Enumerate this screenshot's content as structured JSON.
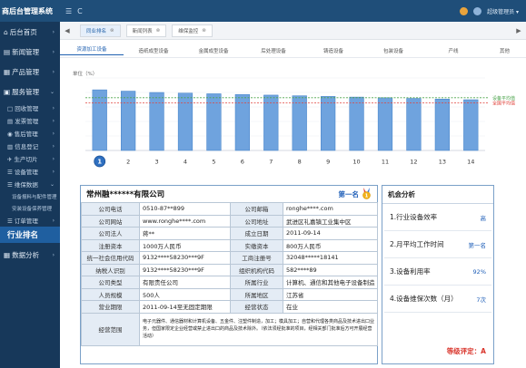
{
  "app": {
    "title": "商后台管理系统",
    "top_icon": "C",
    "user": "超级管理员 ▾"
  },
  "sidebar": {
    "items": [
      {
        "label": "后台首页",
        "icon": "⌂",
        "caret": "›"
      },
      {
        "label": "新闻管理",
        "icon": "▤",
        "caret": "›"
      },
      {
        "label": "产品管理",
        "icon": "▦",
        "caret": "›"
      },
      {
        "label": "服务管理",
        "icon": "▣",
        "caret": "⌄"
      }
    ],
    "subs": [
      {
        "label": "□ 回收管理",
        "caret": "›"
      },
      {
        "label": "▤ 发票管理",
        "caret": "›"
      },
      {
        "label": "◉ 售后管理",
        "caret": "›"
      },
      {
        "label": "▥ 信息登记",
        "caret": "›"
      },
      {
        "label": "✈ 生产切片",
        "caret": "›"
      },
      {
        "label": "☰ 设备管理",
        "caret": "›"
      },
      {
        "label": "☰ 维保数据",
        "caret": "⌄"
      }
    ],
    "subs2": [
      "设备报料与配件管理",
      "安装设备保养管理"
    ],
    "sub_order": {
      "label": "☰ 订单管理",
      "caret": "›"
    },
    "active": "行业排名",
    "bottom": {
      "label": "数据分析",
      "icon": "▦",
      "caret": "›"
    }
  },
  "tabs": {
    "left_arrow": "◀",
    "right_arrow": "▶",
    "items": [
      {
        "label": "同业排名",
        "active": true
      },
      {
        "label": "新闻列表",
        "active": false
      },
      {
        "label": "维保监控",
        "active": false
      }
    ],
    "close": "⊗"
  },
  "categories": [
    "资源加工设备",
    "造纸成型设备",
    "金属成型设备",
    "后处理设备",
    "铸造设备",
    "包装设备",
    "产线",
    "其他"
  ],
  "chart_data": {
    "type": "bar",
    "categories": [
      "1",
      "2",
      "3",
      "4",
      "5",
      "6",
      "7",
      "8",
      "9",
      "10",
      "11",
      "12",
      "13",
      "14"
    ],
    "values": [
      92,
      90,
      88,
      87,
      86,
      85,
      84,
      83,
      82,
      81,
      80,
      79,
      78,
      77
    ],
    "ylabel": "单位（%）",
    "ylim": [
      0,
      110
    ],
    "references": [
      {
        "name": "设备平均值",
        "value": 80,
        "color": "#4aa34a"
      },
      {
        "name": "全国平均值",
        "value": 72,
        "color": "#e0443c"
      }
    ],
    "highlight_index": 0,
    "bar_color": "#6fa3de"
  },
  "company": {
    "name": "常州融******有限公司",
    "rank": "第一名",
    "medal_label": "1",
    "rows": [
      {
        "l1": "公司电话",
        "v1": "0510-87**899",
        "l2": "公司邮箱",
        "v2": "ronghe****.com"
      },
      {
        "l1": "公司网站",
        "v1": "www.ronghe****.com",
        "l2": "公司地址",
        "v2": "武进区礼嘉镇工业集中区"
      },
      {
        "l1": "公司法人",
        "v1": "蒋**",
        "l2": "成立日期",
        "v2": "2011-09-14"
      },
      {
        "l1": "注册资本",
        "v1": "1000万人民币",
        "l2": "实缴资本",
        "v2": "800万人民币"
      },
      {
        "l1": "统一社会信用代码",
        "v1": "9132****58230***9F",
        "l2": "工商注册号",
        "v2": "32048*****18141"
      },
      {
        "l1": "纳税人识别",
        "v1": "9132****58230***9F",
        "l2": "组织机构代码",
        "v2": "582****89"
      },
      {
        "l1": "公司类型",
        "v1": "有限责任公司",
        "l2": "所属行业",
        "v2": "计算机、通信和其他电子设备制造"
      },
      {
        "l1": "人员规模",
        "v1": "500人",
        "l2": "所属地区",
        "v2": "江苏省"
      },
      {
        "l1": "营业期限",
        "v1": "2011-09-14至无固定期限",
        "l2": "经营状态",
        "v2": "在业"
      }
    ],
    "scope_label": "经营范围",
    "scope_text": "电子元器件、通信器材和计算机设备、五金件、注塑件制造，加工；模具加工；自营和代理各类商品及技术进出口业务，但国家限定企业经营或禁止进出口的商品及技术除外。（依法须经批准的项目，经相关部门批准后方可开展经营活动）"
  },
  "opportunity": {
    "title": "机会分析",
    "rows": [
      {
        "label": "1.行业设备效率",
        "value": "高"
      },
      {
        "label": "2.月平均工作时间",
        "value": "第一名"
      },
      {
        "label": "3.设备利用率",
        "value": "92%"
      },
      {
        "label": "4.设备维保次数（月）",
        "value": "7次"
      }
    ],
    "grade": "等级评定：A"
  }
}
